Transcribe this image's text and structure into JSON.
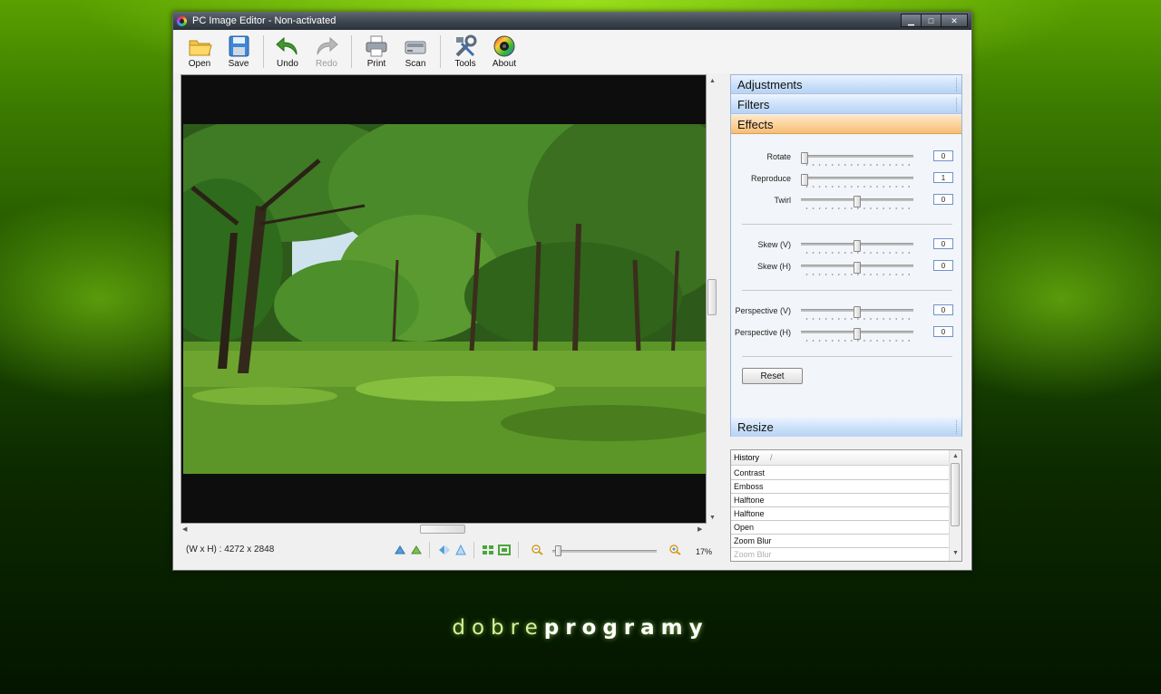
{
  "window": {
    "title": "PC Image Editor - Non-activated",
    "min": "▁",
    "max": "□",
    "close": "✕"
  },
  "toolbar": {
    "open": "Open",
    "save": "Save",
    "undo": "Undo",
    "redo": "Redo",
    "print": "Print",
    "scan": "Scan",
    "tools": "Tools",
    "about": "About"
  },
  "status": {
    "dimensions": "(W x H) : 4272 x 2848",
    "zoom": "17%",
    "zoom_level": 0.17
  },
  "panel": {
    "adjustments": "Adjustments",
    "filters": "Filters",
    "effects": "Effects",
    "resize": "Resize",
    "reset": "Reset",
    "sliders": [
      {
        "label": "Rotate",
        "value": "0"
      },
      {
        "label": "Reproduce",
        "value": "1"
      },
      {
        "label": "Twirl",
        "value": "0"
      },
      {
        "label": "Skew (V)",
        "value": "0"
      },
      {
        "label": "Skew (H)",
        "value": "0"
      },
      {
        "label": "Perspective (V)",
        "value": "0"
      },
      {
        "label": "Perspective (H)",
        "value": "0"
      }
    ]
  },
  "history": {
    "header": "History",
    "sort_mark": "/",
    "items": [
      "Contrast",
      "Emboss",
      "Halftone",
      "Halftone",
      "Open",
      "Zoom Blur",
      "Zoom Blur"
    ]
  },
  "branding": {
    "part1": "dobre",
    "part2": "programy"
  },
  "colors": {
    "accent_active": "#f7bd74",
    "accent_header": "#c8def9",
    "background": "#2f6a00"
  }
}
